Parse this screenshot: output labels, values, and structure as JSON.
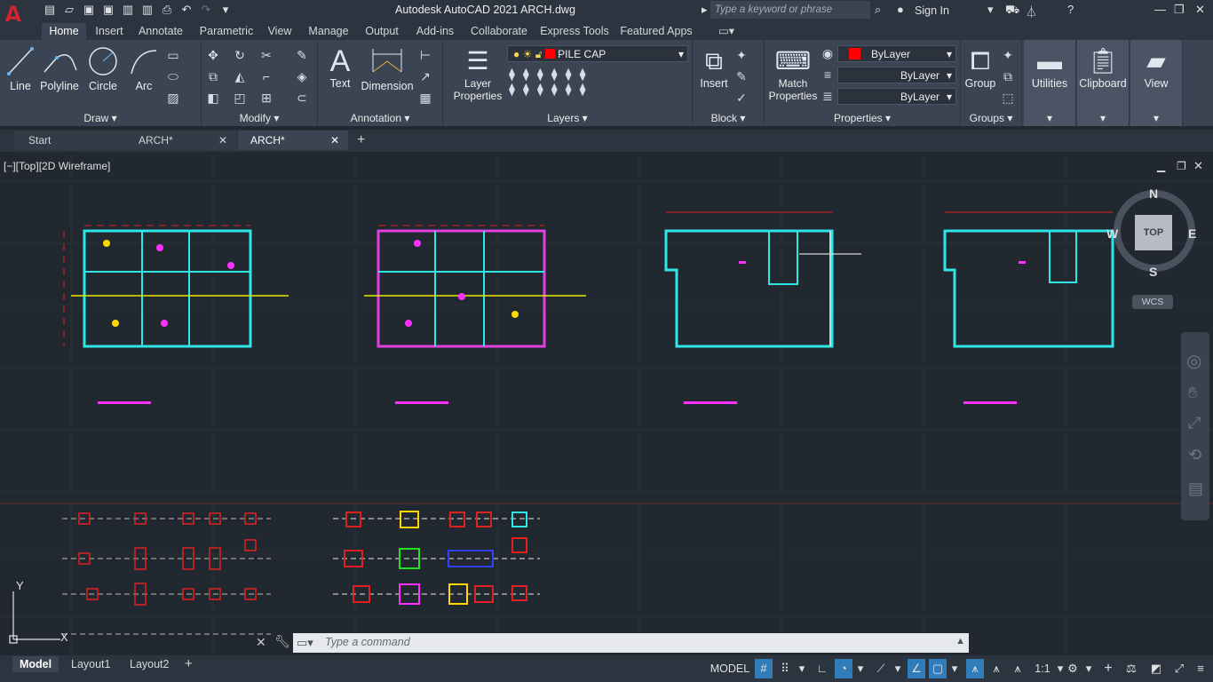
{
  "app": {
    "logo": "A",
    "title": "Autodesk AutoCAD 2021    ARCH.dwg",
    "search_placeholder": "Type a keyword or phrase",
    "sign_in": "Sign In"
  },
  "ribbon_tabs": [
    "Home",
    "Insert",
    "Annotate",
    "Parametric",
    "View",
    "Manage",
    "Output",
    "Add-ins",
    "Collaborate",
    "Express Tools",
    "Featured Apps"
  ],
  "panels": {
    "draw": {
      "label": "Draw",
      "buttons": [
        "Line",
        "Polyline",
        "Circle",
        "Arc"
      ]
    },
    "modify": {
      "label": "Modify"
    },
    "annotation": {
      "label": "Annotation",
      "buttons": [
        "Text",
        "Dimension"
      ]
    },
    "layers": {
      "label": "Layers",
      "layer_properties": "Layer Properties",
      "current_layer": "PILE CAP"
    },
    "block": {
      "label": "Block",
      "insert": "Insert"
    },
    "properties": {
      "label": "Properties",
      "match": "Match Properties",
      "color": "ByLayer",
      "linetype": "ByLayer",
      "lineweight": "ByLayer"
    },
    "groups": {
      "label": "Groups",
      "group": "Group"
    },
    "utilities": "Utilities",
    "clipboard": "Clipboard",
    "view": "View"
  },
  "file_tabs": [
    "Start",
    "ARCH*",
    "ARCH*"
  ],
  "viewport": {
    "label": "[−][Top][2D Wireframe]",
    "viewcube": {
      "top": "TOP",
      "n": "N",
      "s": "S",
      "e": "E",
      "w": "W",
      "wcs": "WCS"
    }
  },
  "command": {
    "placeholder": "Type a command"
  },
  "layout_tabs": [
    "Model",
    "Layout1",
    "Layout2"
  ],
  "status": {
    "model": "MODEL",
    "scale": "1:1"
  },
  "colors": {
    "accent": "#0696d7",
    "ribbon": "#3b4452",
    "bg": "#212830",
    "layer_swatch": "#ff0000"
  }
}
